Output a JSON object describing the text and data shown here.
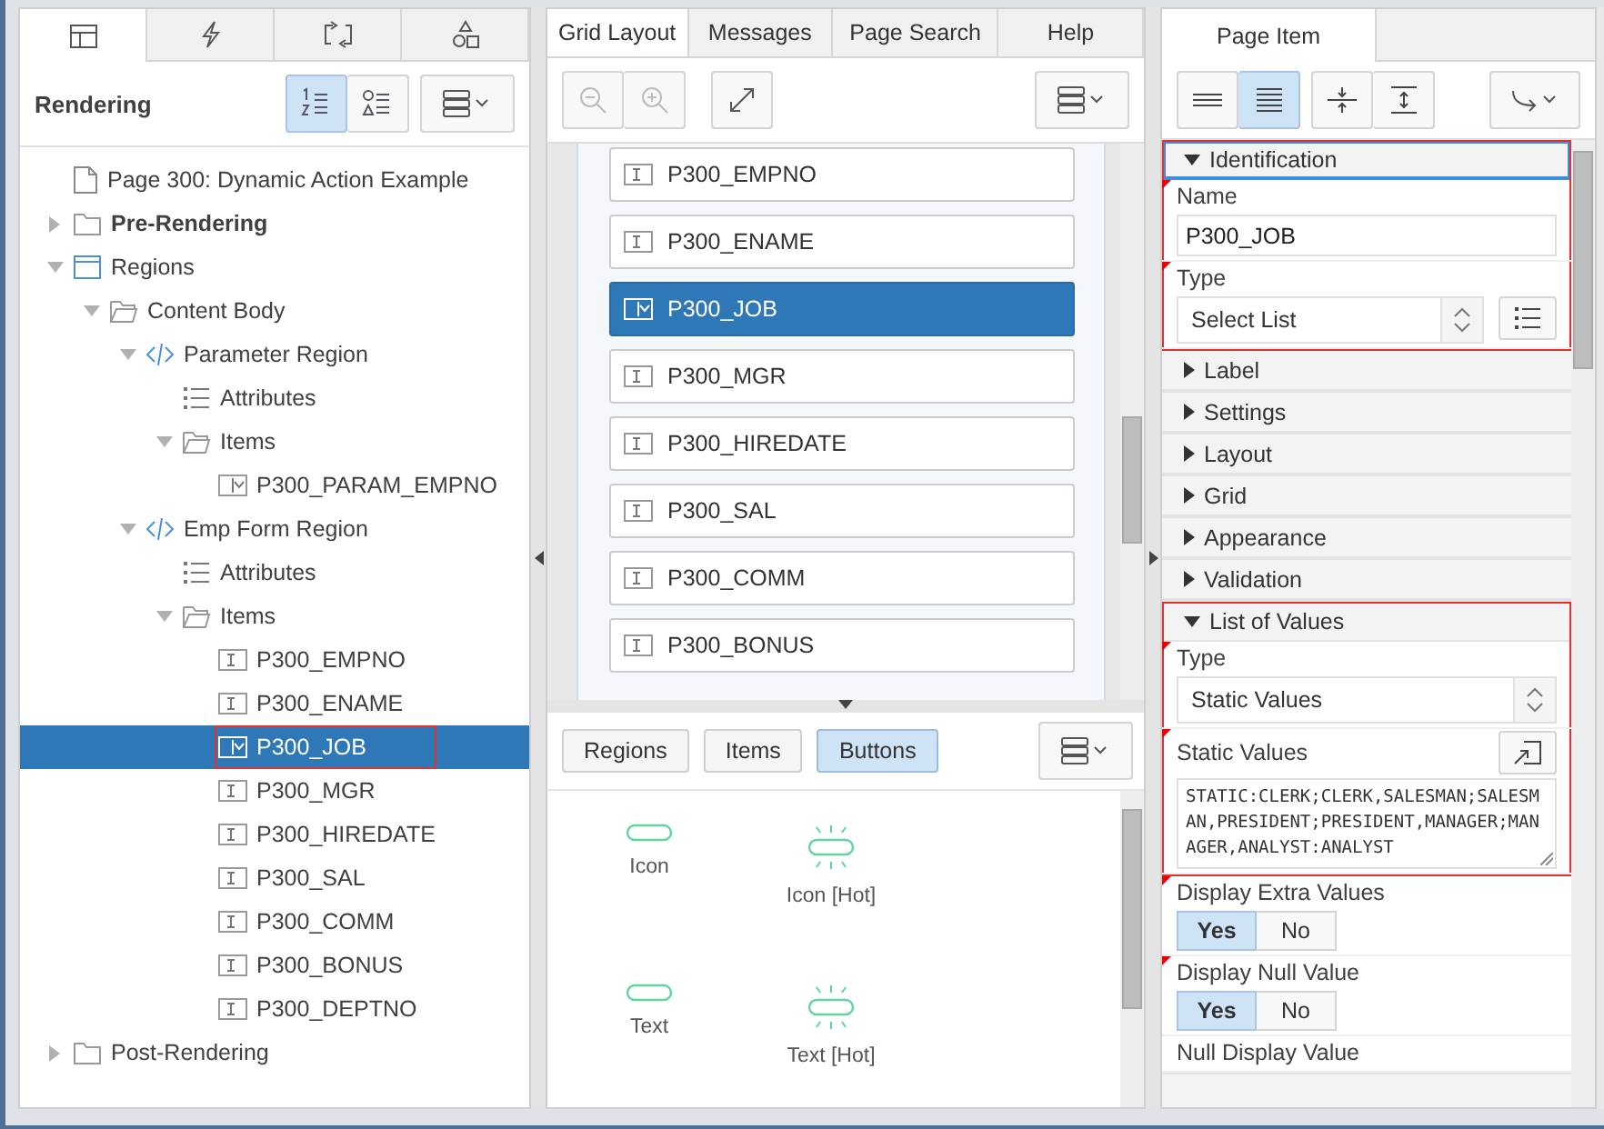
{
  "left_panel": {
    "tabs": [
      {
        "kind": "layout",
        "selected": true
      },
      {
        "kind": "lightning",
        "selected": false
      },
      {
        "kind": "swap",
        "selected": false
      },
      {
        "kind": "shapes",
        "selected": false
      }
    ],
    "title": "Rendering",
    "view_buttons": [
      {
        "kind": "numbered",
        "selected": true
      },
      {
        "kind": "shapes",
        "selected": false
      }
    ],
    "tree": [
      {
        "label": "Page 300: Dynamic Action Example",
        "kind": "page",
        "selected": false
      },
      {
        "label": "Pre-Rendering",
        "kind": "folder",
        "expanded": false,
        "bold": true,
        "selected": false
      },
      {
        "label": "Regions",
        "kind": "region",
        "expanded": true,
        "selected": false,
        "children": [
          {
            "label": "Content Body",
            "kind": "folder-open",
            "expanded": true,
            "selected": false,
            "children": [
              {
                "label": "Parameter Region",
                "kind": "code",
                "expanded": true,
                "selected": false,
                "children": [
                  {
                    "label": "Attributes",
                    "kind": "list",
                    "selected": false
                  },
                  {
                    "label": "Items",
                    "kind": "folder-open",
                    "expanded": true,
                    "selected": false,
                    "children": [
                      {
                        "label": "P300_PARAM_EMPNO",
                        "kind": "select",
                        "selected": false
                      }
                    ]
                  }
                ]
              },
              {
                "label": "Emp Form Region",
                "kind": "code",
                "expanded": true,
                "selected": false,
                "children": [
                  {
                    "label": "Attributes",
                    "kind": "list",
                    "selected": false
                  },
                  {
                    "label": "Items",
                    "kind": "folder-open",
                    "expanded": true,
                    "selected": false,
                    "children": [
                      {
                        "label": "P300_EMPNO",
                        "kind": "text",
                        "selected": false
                      },
                      {
                        "label": "P300_ENAME",
                        "kind": "text",
                        "selected": false
                      },
                      {
                        "label": "P300_JOB",
                        "kind": "select",
                        "selected": true,
                        "highlighted": true
                      },
                      {
                        "label": "P300_MGR",
                        "kind": "text",
                        "selected": false
                      },
                      {
                        "label": "P300_HIREDATE",
                        "kind": "text",
                        "selected": false
                      },
                      {
                        "label": "P300_SAL",
                        "kind": "text",
                        "selected": false
                      },
                      {
                        "label": "P300_COMM",
                        "kind": "text",
                        "selected": false
                      },
                      {
                        "label": "P300_BONUS",
                        "kind": "text",
                        "selected": false
                      },
                      {
                        "label": "P300_DEPTNO",
                        "kind": "text",
                        "selected": false
                      }
                    ]
                  }
                ]
              }
            ]
          }
        ]
      },
      {
        "label": "Post-Rendering",
        "kind": "folder",
        "expanded": false,
        "selected": false
      }
    ]
  },
  "center_panel": {
    "tabs": [
      {
        "label": "Grid Layout",
        "selected": true
      },
      {
        "label": "Messages",
        "selected": false
      },
      {
        "label": "Page Search",
        "selected": false
      },
      {
        "label": "Help",
        "selected": false
      }
    ],
    "zoom_buttons": [
      {
        "kind": "zoom-out",
        "disabled": true
      },
      {
        "kind": "zoom-in",
        "disabled": true
      }
    ],
    "grid_items": [
      {
        "label": "P300_EMPNO",
        "kind": "text",
        "selected": false
      },
      {
        "label": "P300_ENAME",
        "kind": "text",
        "selected": false
      },
      {
        "label": "P300_JOB",
        "kind": "select",
        "selected": true
      },
      {
        "label": "P300_MGR",
        "kind": "text",
        "selected": false
      },
      {
        "label": "P300_HIREDATE",
        "kind": "text",
        "selected": false
      },
      {
        "label": "P300_SAL",
        "kind": "text",
        "selected": false
      },
      {
        "label": "P300_COMM",
        "kind": "text",
        "selected": false
      },
      {
        "label": "P300_BONUS",
        "kind": "text",
        "selected": false
      }
    ],
    "gallery_tabs": [
      {
        "label": "Regions",
        "selected": false
      },
      {
        "label": "Items",
        "selected": false
      },
      {
        "label": "Buttons",
        "selected": true
      }
    ],
    "gallery_items": [
      {
        "label": "Icon",
        "hot": false
      },
      {
        "label": "Icon [Hot]",
        "hot": true
      },
      {
        "label": "Text",
        "hot": false
      },
      {
        "label": "Text [Hot]",
        "hot": true
      }
    ]
  },
  "right_panel": {
    "tabs": [
      {
        "label": "Page Item",
        "selected": true
      }
    ],
    "view_buttons": [
      {
        "kind": "compact",
        "selected": false
      },
      {
        "kind": "full",
        "selected": true
      },
      {
        "kind": "collapse-all",
        "selected": false
      },
      {
        "kind": "expand-all",
        "selected": false
      }
    ],
    "groups": [
      {
        "title": "Identification",
        "expanded": true,
        "highlighted": true,
        "focused": true,
        "fields": [
          {
            "kind": "text",
            "label": "Name",
            "value": "P300_JOB",
            "required": true
          },
          {
            "kind": "select",
            "label": "Type",
            "value": "Select List",
            "required": true,
            "list_button": true
          }
        ]
      },
      {
        "title": "Label",
        "expanded": false,
        "highlighted": false
      },
      {
        "title": "Settings",
        "expanded": false,
        "highlighted": false
      },
      {
        "title": "Layout",
        "expanded": false,
        "highlighted": false
      },
      {
        "title": "Grid",
        "expanded": false,
        "highlighted": false
      },
      {
        "title": "Appearance",
        "expanded": false,
        "highlighted": false
      },
      {
        "title": "Validation",
        "expanded": false,
        "highlighted": false
      },
      {
        "title": "List of Values",
        "expanded": true,
        "highlighted": true,
        "fields": [
          {
            "kind": "select",
            "label": "Type",
            "value": "Static Values",
            "required": true
          },
          {
            "kind": "textarea",
            "label": "Static Values",
            "value": "STATIC:CLERK;CLERK,SALESMAN;SALESMAN,PRESIDENT;PRESIDENT,MANAGER;MANAGER,ANALYST:ANALYST",
            "required": true
          }
        ]
      },
      {
        "fields": [
          {
            "kind": "toggle",
            "label": "Display Extra Values",
            "required": true,
            "options": [
              {
                "label": "Yes",
                "selected": true
              },
              {
                "label": "No",
                "selected": false
              }
            ]
          },
          {
            "kind": "toggle",
            "label": "Display Null Value",
            "required": true,
            "options": [
              {
                "label": "Yes",
                "selected": true
              },
              {
                "label": "No",
                "selected": false
              }
            ]
          },
          {
            "kind": "label",
            "label": "Null Display Value",
            "required": false
          }
        ]
      }
    ]
  }
}
